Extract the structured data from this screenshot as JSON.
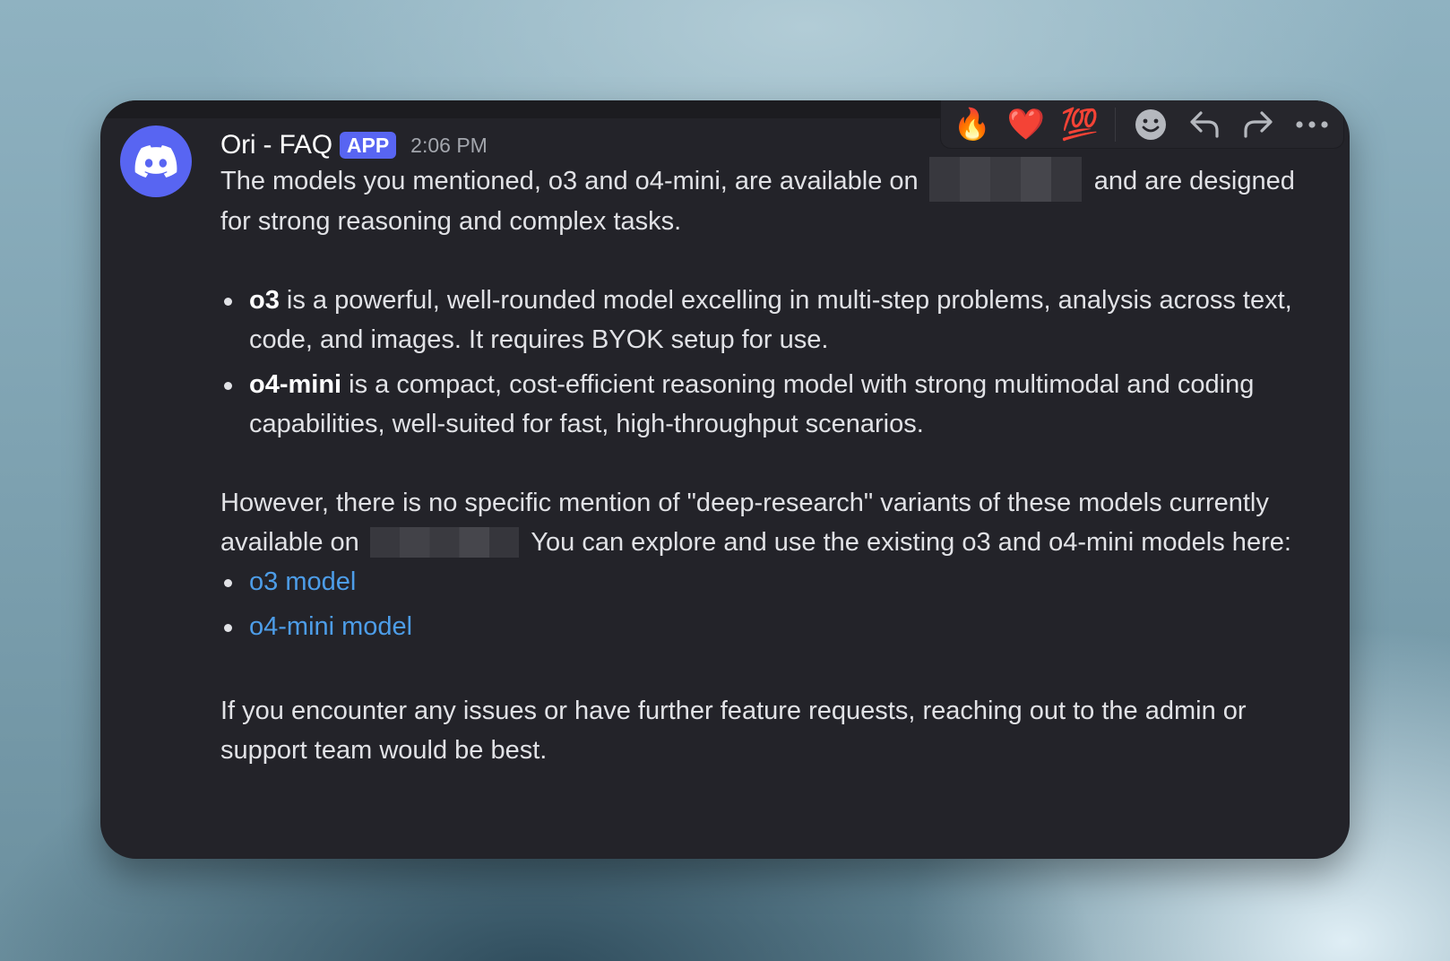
{
  "message": {
    "author": "Ori - FAQ",
    "badge": "APP",
    "timestamp": "2:06 PM",
    "intro_before": "The models you mentioned, o3 and o4-mini, are available on ",
    "intro_after": " and are designed for strong reasoning and complex tasks.",
    "bullets": [
      {
        "bold": "o3",
        "text": " is a powerful, well-rounded model excelling in multi-step problems, analysis across text, code, and images. It requires BYOK setup for use."
      },
      {
        "bold": "o4-mini",
        "text": " is a compact, cost-efficient reasoning model with strong multimodal and coding capabilities, well-suited for fast, high-throughput scenarios."
      }
    ],
    "however_before": "However, there is no specific mention of \"deep-research\" variants of these models currently available on ",
    "however_after": " You can explore and use the existing o3 and o4-mini models here:",
    "links": [
      "o3 model",
      "o4-mini model"
    ],
    "closing": "If you encounter any issues or have further feature requests, reaching out to the admin or support team would be best."
  },
  "toolbar": {
    "reactions": [
      "🔥",
      "❤️",
      "💯"
    ],
    "actions": [
      "add-reaction-icon",
      "reply-icon",
      "forward-icon",
      "more-icon"
    ]
  },
  "colors": {
    "accent": "#5865f2",
    "link": "#4d9de8",
    "card_bg": "#232329"
  }
}
